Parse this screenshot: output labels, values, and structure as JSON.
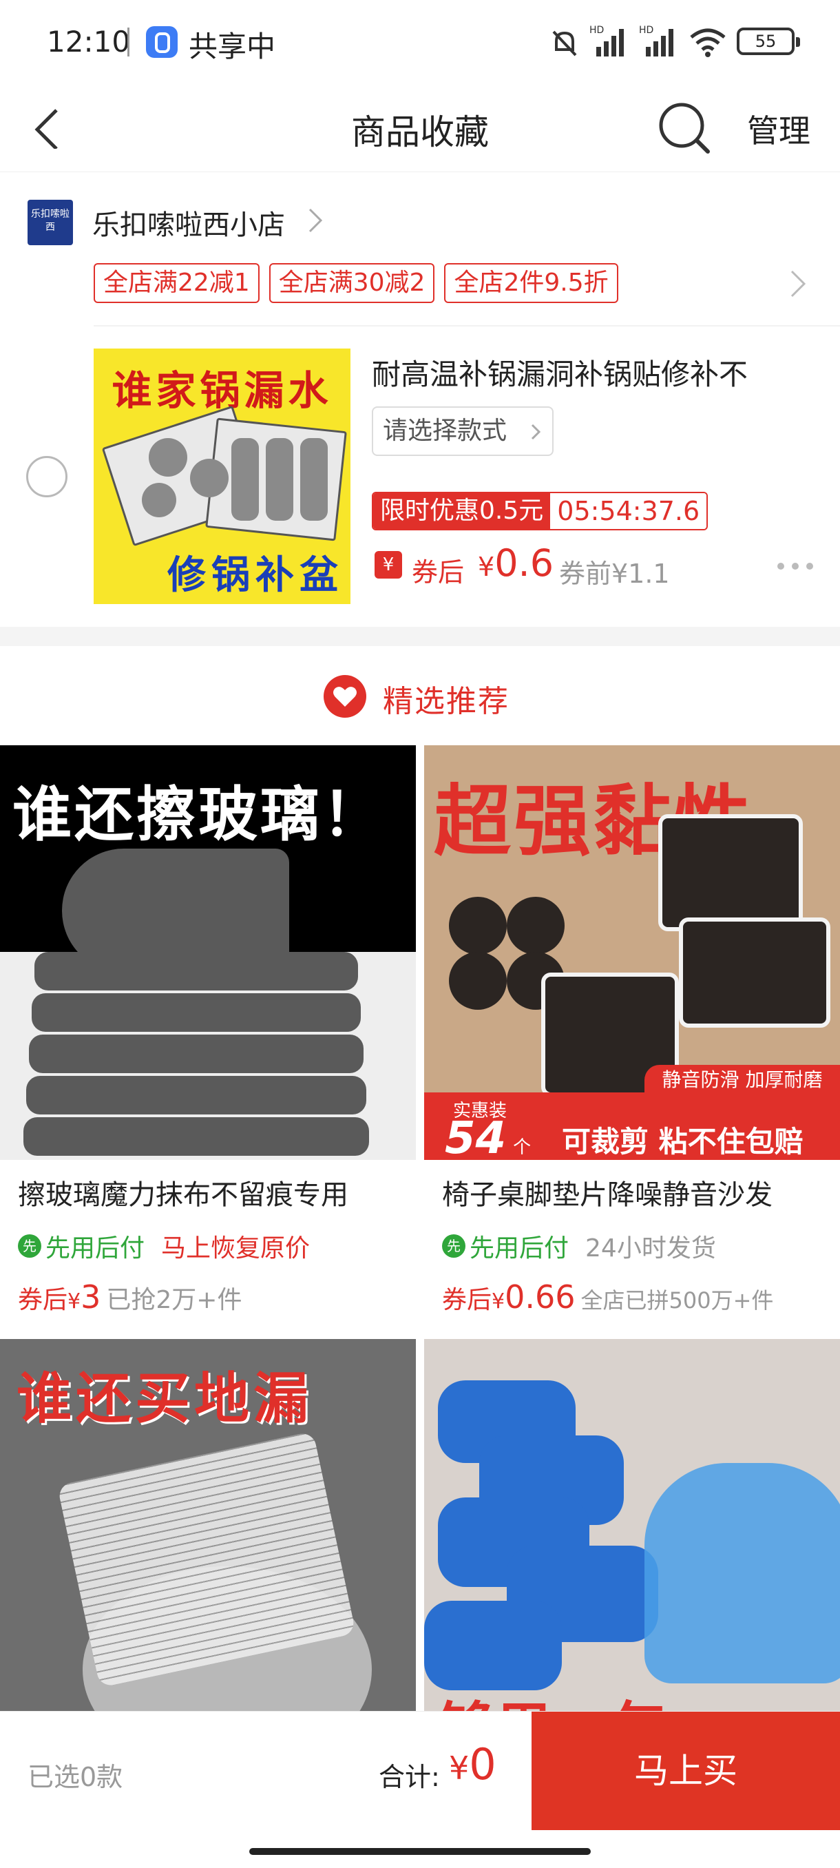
{
  "status_bar": {
    "time": "12:10",
    "sharing": "共享中",
    "battery": "55"
  },
  "nav": {
    "title": "商品收藏",
    "manage": "管理"
  },
  "store": {
    "logo_text": "乐扣嗦啦西",
    "name": "乐扣嗦啦西小店",
    "promos": [
      "全店满22减1",
      "全店满30减2",
      "全店2件9.5折"
    ]
  },
  "favorite_item": {
    "image_text_top": "谁家锅漏水",
    "image_text_bottom": "修锅补盆",
    "title": "耐高温补锅漏洞补锅贴修补不",
    "select_style": "请选择款式",
    "flash_label": "限时优惠0.5元",
    "countdown": "05:54:37.6",
    "coupon_icon": "¥",
    "price_label": "券后",
    "price_yen": "¥",
    "price_value": "0.6",
    "price_before": "券前¥1.1"
  },
  "recommend": {
    "title": "精选推荐"
  },
  "products": [
    {
      "image_text": "谁还擦玻璃！",
      "title": "擦玻璃魔力抹布不留痕专用",
      "tag_icon": "先",
      "tag_green": "先用后付",
      "tag_second": "马上恢复原价",
      "price_label": "券后",
      "price_yen": "¥",
      "price_value": "3",
      "sold": "已抢2万+件"
    },
    {
      "image_text": "超强黏性",
      "image_banner_top": "静音防滑 加厚耐磨",
      "image_banner_label": "实惠装",
      "image_banner_num": "54",
      "image_banner_unit": "个",
      "image_banner_text": "可裁剪 粘不住包赔",
      "title": "椅子桌脚垫片降噪静音沙发",
      "tag_icon": "先",
      "tag_green": "先用后付",
      "tag_second": "24小时发货",
      "price_label": "券后",
      "price_yen": "¥",
      "price_value": "0.66",
      "sold": "全店已拼500万+件"
    },
    {
      "image_text": "谁还买地漏"
    },
    {
      "image_text": "够用一年"
    }
  ],
  "bottom_bar": {
    "selected": "已选0款",
    "total_label": "合计:",
    "total_yen": "¥",
    "total_value": "0",
    "buy": "马上买"
  },
  "colors": {
    "accent_red": "#e0302a",
    "green": "#2fa63a"
  }
}
